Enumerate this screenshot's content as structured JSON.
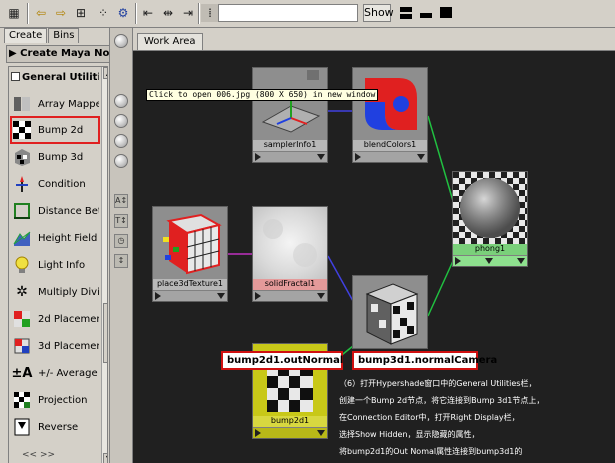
{
  "toolbar": {
    "show_label": "Show",
    "search_value": ""
  },
  "left_panel": {
    "tabs": [
      {
        "label": "Create"
      },
      {
        "label": "Bins"
      }
    ],
    "create_header": "Create Maya Node",
    "category_header": "General Utilities",
    "items": [
      {
        "label": "Array Mapper",
        "icon": "array-mapper-icon"
      },
      {
        "label": "Bump 2d",
        "icon": "bump-2d-icon"
      },
      {
        "label": "Bump 3d",
        "icon": "bump-3d-icon"
      },
      {
        "label": "Condition",
        "icon": "condition-icon"
      },
      {
        "label": "Distance Bet",
        "icon": "distance-between-icon"
      },
      {
        "label": "Height Field",
        "icon": "height-field-icon"
      },
      {
        "label": "Light Info",
        "icon": "light-info-icon"
      },
      {
        "label": "Multiply Divid",
        "icon": "multiply-divide-icon"
      },
      {
        "label": "2d Placemen",
        "icon": "2d-placement-icon"
      },
      {
        "label": "3d Placemen",
        "icon": "3d-placement-icon"
      },
      {
        "label": "+/- Average",
        "icon": "plus-minus-average-icon"
      },
      {
        "label": "Projection",
        "icon": "projection-icon"
      },
      {
        "label": "Reverse",
        "icon": "reverse-icon"
      }
    ],
    "bottom_nav": "<<        >>"
  },
  "work_area": {
    "tab_label": "Work Area",
    "tooltip": "Click to open 006.jpg (800 X 650) in new window",
    "nodes": [
      {
        "name": "samplerInfo1"
      },
      {
        "name": "blendColors1"
      },
      {
        "name": "phong1"
      },
      {
        "name": "place3dTexture1"
      },
      {
        "name": "solidFractal1"
      },
      {
        "name": "bump3d1"
      },
      {
        "name": "bump2d1"
      }
    ],
    "callouts": {
      "left": "bump2d1.outNormal",
      "right": "bump3d1.normalCamera"
    },
    "description": [
      "（6）打开Hypershade窗口中的General Utilities栏，",
      "创建一个Bump 2d节点，将它连接到Bump 3d1节点上，",
      "在Connection Editor中，打开Right Display栏，",
      "选择Show Hidden，显示隐藏的属性，",
      "将bump2d1的Out Nomal属性连接到bump3d1的"
    ]
  },
  "colors": {
    "canvas": "#202020",
    "highlight": "#e02020",
    "wire_green": "#20c040",
    "wire_blue": "#4040e0",
    "wire_purple": "#c030c0"
  }
}
